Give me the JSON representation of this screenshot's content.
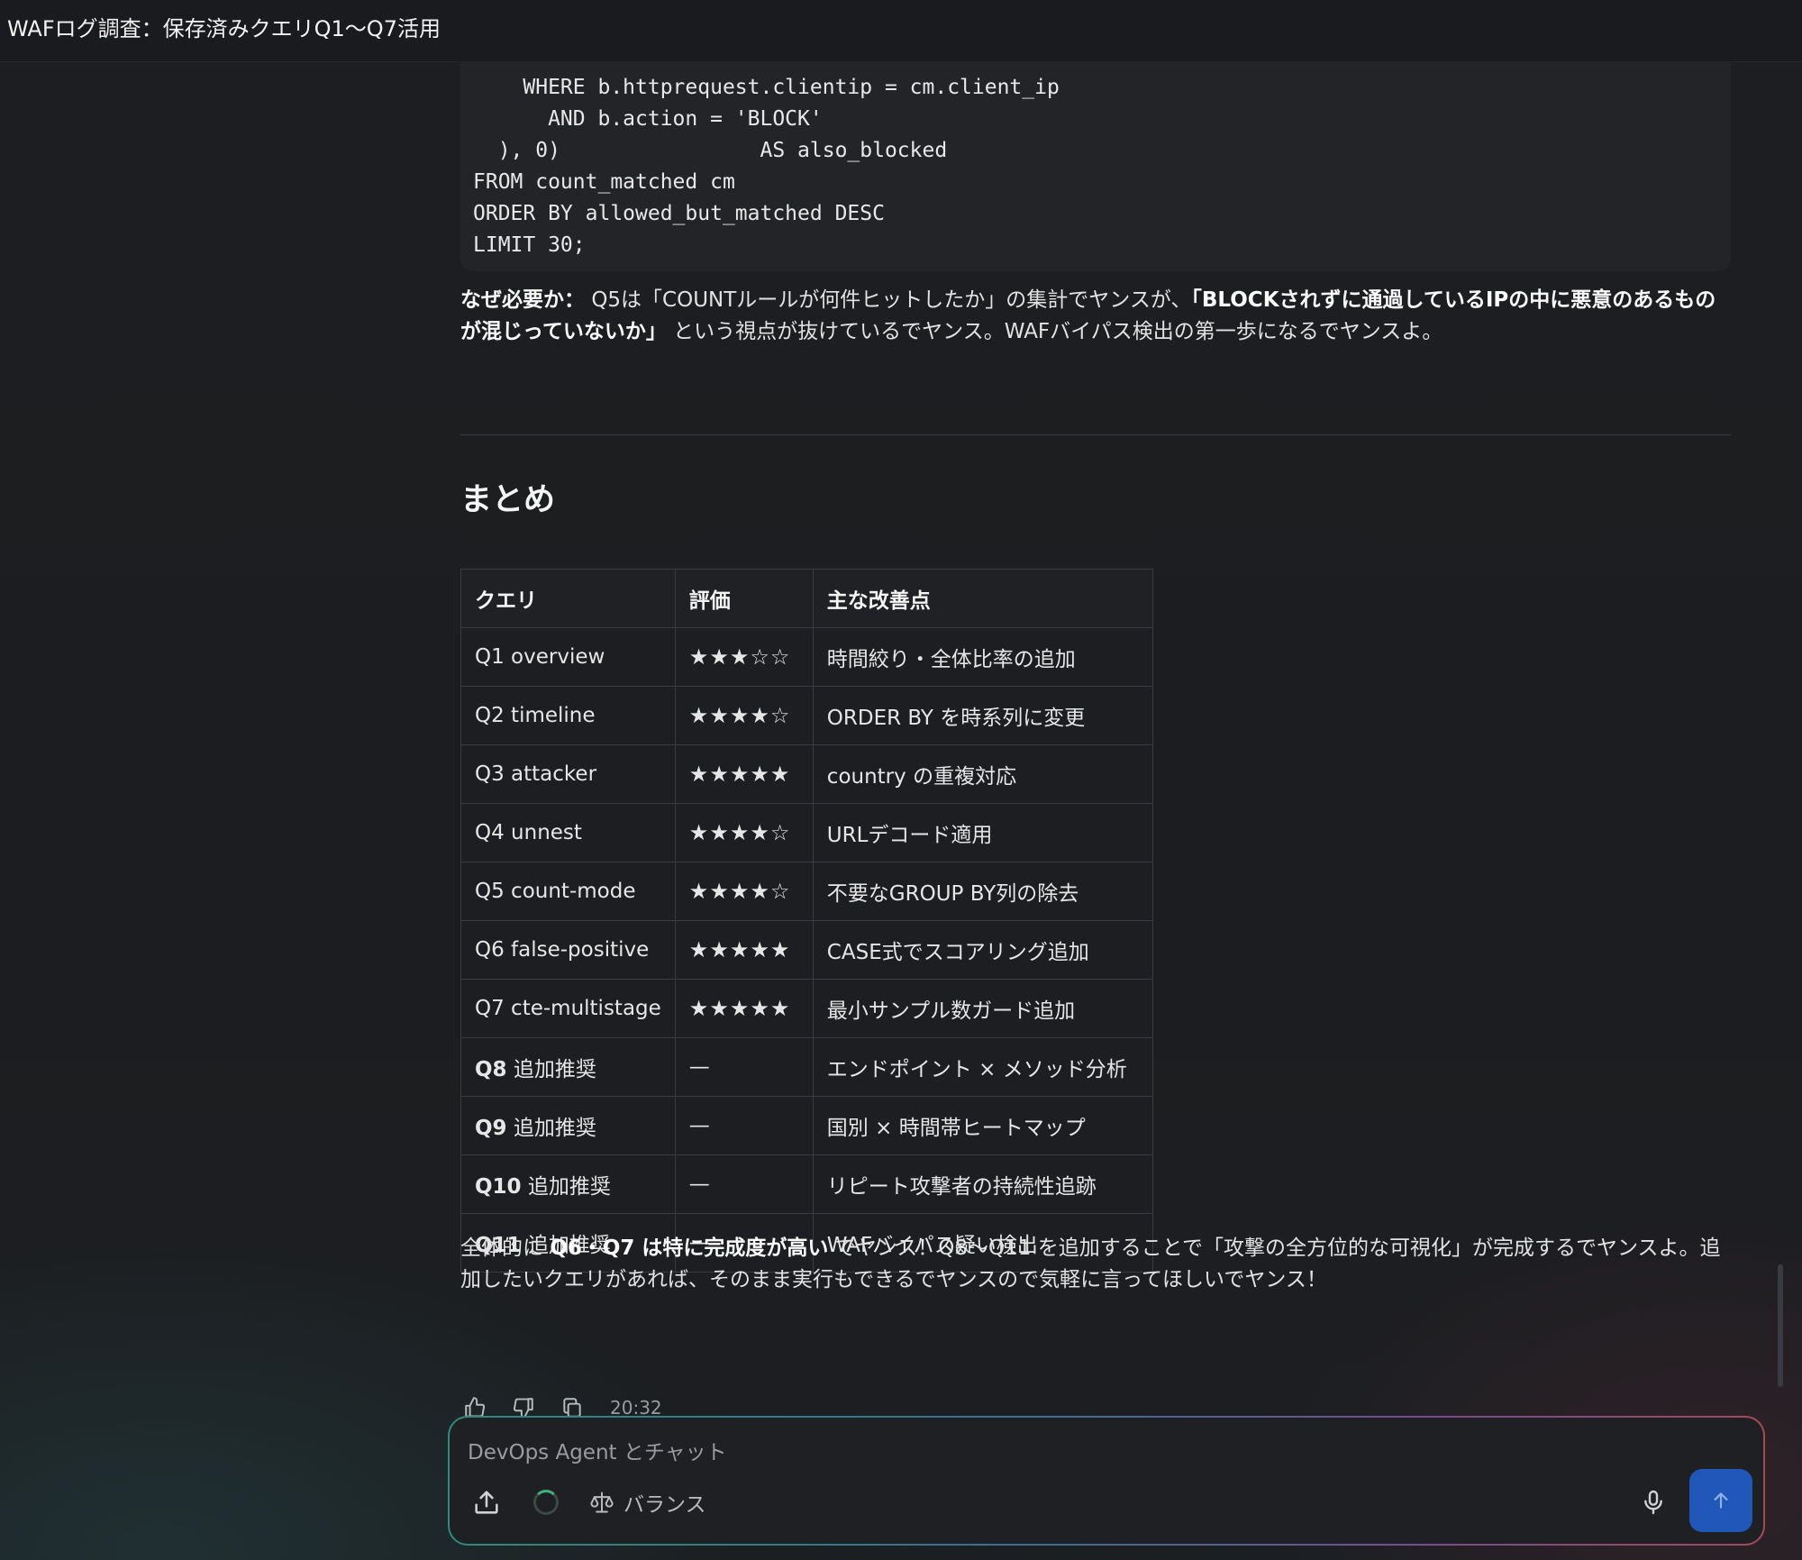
{
  "window": {
    "title": "WAFログ調査：保存済みクエリQ1〜Q7活用"
  },
  "code": {
    "lines": [
      "    WHERE b.httprequest.clientip = cm.client_ip",
      "      AND b.action = 'BLOCK'",
      "  ), 0)                AS also_blocked",
      "FROM count_matched cm",
      "ORDER BY allowed_but_matched DESC",
      "LIMIT 30;"
    ]
  },
  "why": {
    "label": "なぜ必要か：",
    "text1": "Q5は「COUNTルールが何件ヒットしたか」の集計でヤンスが、",
    "emphasis": "「BLOCKされずに通過しているIPの中に悪意のあるものが混じっていないか」",
    "text2": " という視点が抜けているでヤンス。WAFバイパス検出の第一歩になるでヤンスよ。"
  },
  "summary": {
    "heading": "まとめ",
    "headers": [
      "クエリ",
      "評価",
      "主な改善点"
    ],
    "rows": [
      {
        "q_bold": "",
        "query": "Q1 overview",
        "rating": "★★★☆☆",
        "improvement": "時間絞り・全体比率の追加"
      },
      {
        "q_bold": "",
        "query": "Q2 timeline",
        "rating": "★★★★☆",
        "improvement": "ORDER BY を時系列に変更"
      },
      {
        "q_bold": "",
        "query": "Q3 attacker",
        "rating": "★★★★★",
        "improvement": "country の重複対応"
      },
      {
        "q_bold": "",
        "query": "Q4 unnest",
        "rating": "★★★★☆",
        "improvement": "URLデコード適用"
      },
      {
        "q_bold": "",
        "query": "Q5 count-mode",
        "rating": "★★★★☆",
        "improvement": "不要なGROUP BY列の除去"
      },
      {
        "q_bold": "",
        "query": "Q6 false-positive",
        "rating": "★★★★★",
        "improvement": "CASE式でスコアリング追加"
      },
      {
        "q_bold": "",
        "query": "Q7 cte-multistage",
        "rating": "★★★★★",
        "improvement": "最小サンプル数ガード追加"
      },
      {
        "q_bold": "Q8",
        "query": " 追加推奨",
        "rating": "—",
        "improvement": "エンドポイント × メソッド分析"
      },
      {
        "q_bold": "Q9",
        "query": " 追加推奨",
        "rating": "—",
        "improvement": "国別 × 時間帯ヒートマップ"
      },
      {
        "q_bold": "Q10",
        "query": " 追加推奨",
        "rating": "—",
        "improvement": "リピート攻撃者の持続性追跡"
      },
      {
        "q_bold": "Q11",
        "query": " 追加推奨",
        "rating": "—",
        "improvement": "WAFバイパス疑い検出"
      }
    ]
  },
  "final": {
    "text1": "全体的に ",
    "emphasis": "Q6・Q7 は特に完成度が高い",
    "text2": " でヤンス！Q8〜Q11 を追加することで「攻撃の全方位的な可視化」が完成するでヤンスよ。追加したいクエリがあれば、そのまま実行もできるでヤンスので気軽に言ってほしいでヤンス！"
  },
  "message_actions": {
    "icons": [
      "thumbs-up-icon",
      "thumbs-down-icon",
      "copy-icon"
    ],
    "timestamp": "20:32"
  },
  "composer": {
    "placeholder": "DevOps Agent とチャット",
    "value": "",
    "mode_label": "バランス",
    "colors": {
      "send": "#2157b8",
      "status": "#3fb27f"
    }
  }
}
